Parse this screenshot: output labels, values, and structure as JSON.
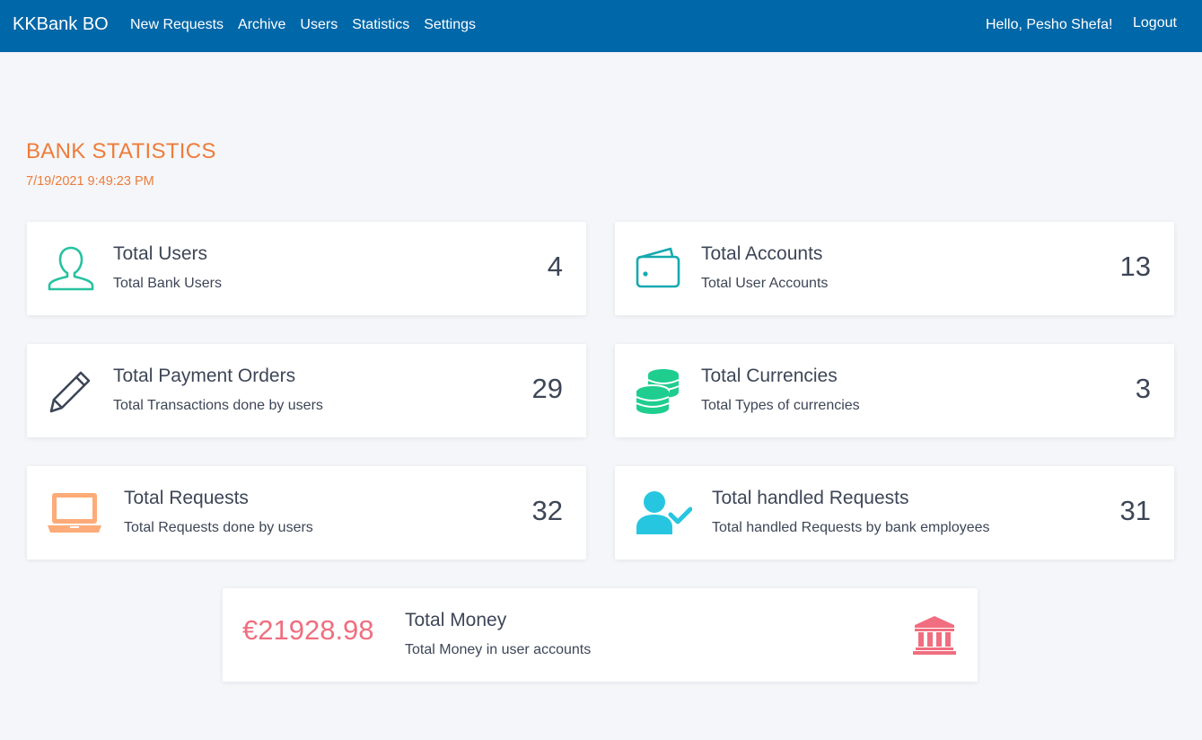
{
  "nav": {
    "brand": "KKBank BO",
    "links": [
      "New Requests",
      "Archive",
      "Users",
      "Statistics",
      "Settings"
    ],
    "greeting": "Hello, Pesho Shefa!",
    "logout": "Logout"
  },
  "header": {
    "title": "BANK STATISTICS",
    "timestamp": "7/19/2021 9:49:23 PM"
  },
  "cards": [
    {
      "title": "Total Users",
      "subtitle": "Total Bank Users",
      "value": "4",
      "icon": "user-outline-icon",
      "color": "#27c1a0"
    },
    {
      "title": "Total Accounts",
      "subtitle": "Total User Accounts",
      "value": "13",
      "icon": "wallet-icon",
      "color": "#17a9b0"
    },
    {
      "title": "Total Payment Orders",
      "subtitle": "Total Transactions done by users",
      "value": "29",
      "icon": "pencil-icon",
      "color": "#3d4657"
    },
    {
      "title": "Total Currencies",
      "subtitle": "Total Types of currencies",
      "value": "3",
      "icon": "coins-icon",
      "color": "#1fce8f"
    },
    {
      "title": "Total Requests",
      "subtitle": "Total Requests done by users",
      "value": "32",
      "icon": "laptop-icon",
      "color": "#fdab78"
    },
    {
      "title": "Total handled Requests",
      "subtitle": "Total handled Requests by bank employees",
      "value": "31",
      "icon": "user-check-icon",
      "color": "#27c6e0"
    }
  ],
  "money": {
    "value": "€21928.98",
    "title": "Total Money",
    "subtitle": "Total Money in user accounts",
    "icon": "bank-icon",
    "color": "#f06e7f"
  }
}
